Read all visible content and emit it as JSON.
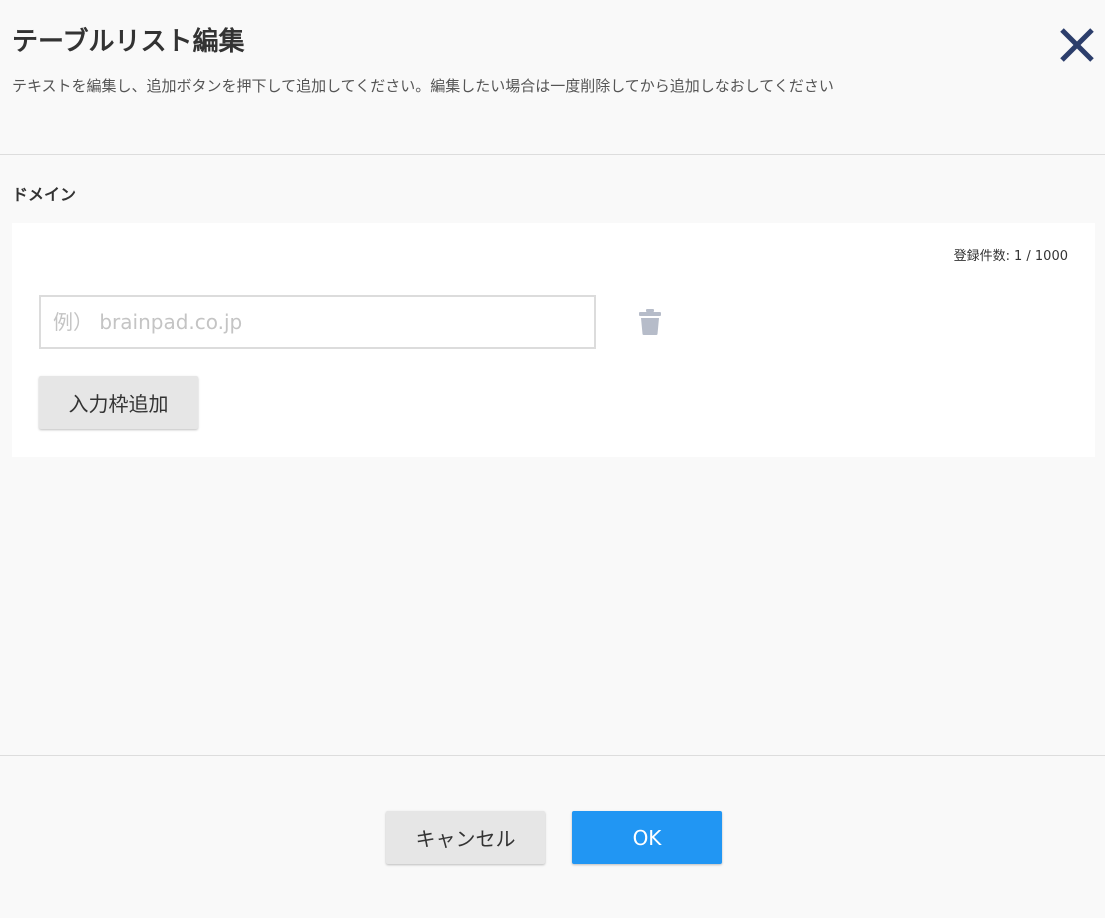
{
  "dialog": {
    "title": "テーブルリスト編集",
    "subtitle": "テキストを編集し、追加ボタンを押下して追加してください。編集したい場合は一度削除してから追加しなおしてください",
    "close_icon": "close-icon"
  },
  "domain_section": {
    "label": "ドメイン",
    "count_label": "登録件数:",
    "count_value": "1 / 1000",
    "input": {
      "value": "",
      "placeholder": "例） brainpad.co.jp"
    },
    "delete_icon": "trash-icon",
    "add_field_label": "入力枠追加"
  },
  "footer": {
    "cancel_label": "キャンセル",
    "ok_label": "OK"
  },
  "colors": {
    "accent": "#2196f3",
    "close_icon": "#2c3e6b",
    "trash_icon": "#b6bcc9",
    "background": "#f9f9f9",
    "card": "#ffffff",
    "secondary_button": "#e6e6e6"
  }
}
